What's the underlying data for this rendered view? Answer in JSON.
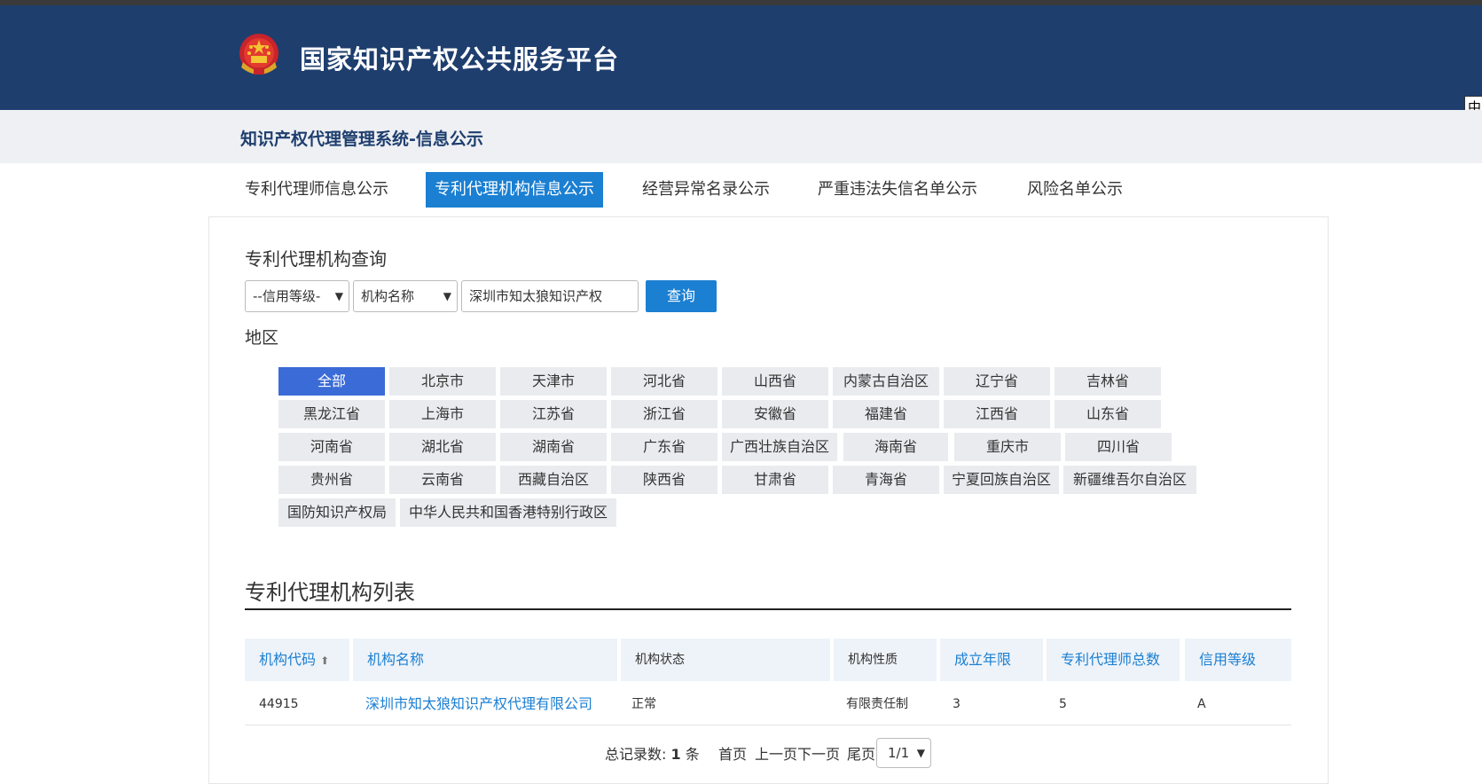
{
  "header": {
    "site_title": "国家知识产权公共服务平台",
    "lang_button": "中"
  },
  "subheader": {
    "title": "知识产权代理管理系统-信息公示"
  },
  "tabs": [
    {
      "label": "专利代理师信息公示",
      "active": false
    },
    {
      "label": "专利代理机构信息公示",
      "active": true
    },
    {
      "label": "经营异常名录公示",
      "active": false
    },
    {
      "label": "严重违法失信名单公示",
      "active": false
    },
    {
      "label": "风险名单公示",
      "active": false
    }
  ],
  "query": {
    "title": "专利代理机构查询",
    "credit_select": "--信用等级-",
    "field_select": "机构名称",
    "search_value": "深圳市知太狼知识产权",
    "search_button": "查询",
    "region_label": "地区"
  },
  "regions": [
    "全部",
    "北京市",
    "天津市",
    "河北省",
    "山西省",
    "内蒙古自治区",
    "辽宁省",
    "吉林省",
    "黑龙江省",
    "上海市",
    "江苏省",
    "浙江省",
    "安徽省",
    "福建省",
    "江西省",
    "山东省",
    "河南省",
    "湖北省",
    "湖南省",
    "广东省",
    "广西壮族自治区",
    "海南省",
    "重庆市",
    "四川省",
    "贵州省",
    "云南省",
    "西藏自治区",
    "陕西省",
    "甘肃省",
    "青海省",
    "宁夏回族自治区",
    "新疆维吾尔自治区",
    "国防知识产权局",
    "中华人民共和国香港特别行政区"
  ],
  "active_region": "全部",
  "list": {
    "title": "专利代理机构列表",
    "columns": [
      "机构代码",
      "机构名称",
      "机构状态",
      "机构性质",
      "成立年限",
      "专利代理师总数",
      "信用等级"
    ],
    "sort_arrow": "⬆",
    "rows": [
      [
        "44915",
        "深圳市知太狼知识产权代理有限公司",
        "正常",
        "有限责任制",
        "3",
        "5",
        "A"
      ]
    ]
  },
  "pager": {
    "total_label": "总记录数:",
    "total_value": "1",
    "total_unit": "条",
    "first": "首页",
    "prev": "上一页",
    "next": "下一页",
    "last": "尾页",
    "page_select": "1/1"
  },
  "colors": {
    "header_bg": "#1e3e6e",
    "accent": "#1b7fd2",
    "active_region": "#3b6bd6"
  }
}
